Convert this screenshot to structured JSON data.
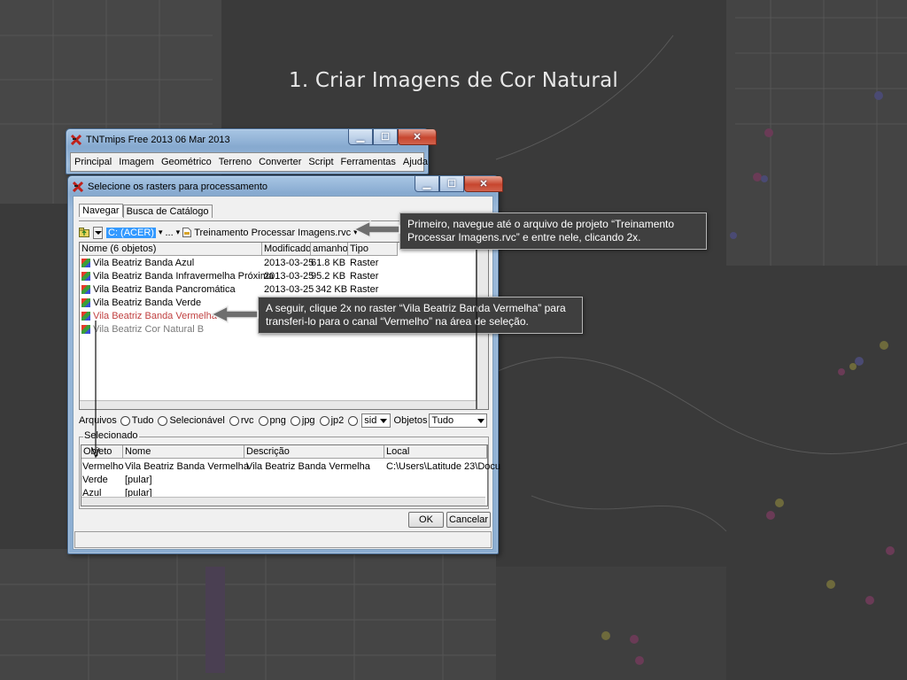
{
  "slide": {
    "title": "1. Criar Imagens de Cor Natural"
  },
  "main_window": {
    "title": "TNTmips Free 2013   06 Mar 2013",
    "menu": [
      "Principal",
      "Imagem",
      "Geométrico",
      "Terreno",
      "Converter",
      "Script",
      "Ferramentas",
      "Ajuda"
    ]
  },
  "dialog": {
    "title": "Selecione os rasters para processamento",
    "tabs": [
      "Navegar",
      "Busca de Catálogo"
    ],
    "path": {
      "drive": "C: (ACER)",
      "ellipsis": "...",
      "project": "Treinamento Processar Imagens.rvc"
    },
    "list_headers": [
      "Nome  (6 objetos)",
      "Modificado",
      "amanho",
      "Tipo"
    ],
    "list_rows": [
      {
        "name": "Vila Beatriz Banda Azul",
        "modified": "2013-03-25",
        "size": "61.8 KB",
        "type": "Raster"
      },
      {
        "name": "Vila Beatriz Banda Infravermelha Próxima",
        "modified": "2013-03-25",
        "size": "95.2 KB",
        "type": "Raster"
      },
      {
        "name": "Vila Beatriz Banda Pancromática",
        "modified": "2013-03-25",
        "size": "342 KB",
        "type": "Raster"
      },
      {
        "name": "Vila Beatriz Banda Verde",
        "modified": "",
        "size": "",
        "type": ""
      },
      {
        "name": "Vila Beatriz Banda Vermelha",
        "modified": "",
        "size": "",
        "type": ""
      },
      {
        "name": "Vila Beatriz Cor Natural B",
        "modified": "",
        "size": "",
        "type": ""
      }
    ],
    "filter": {
      "label": "Arquivos",
      "options": [
        "Tudo",
        "Selecionável",
        "rvc",
        "png",
        "jpg",
        "jp2"
      ],
      "ext_value": "sid",
      "objects_label": "Objetos",
      "objects_value": "Tudo"
    },
    "selected_group": {
      "title": "Selecionado",
      "headers": [
        "Objeto",
        "Nome",
        "Descrição",
        "Local"
      ],
      "rows": [
        {
          "object": "Vermelho",
          "name": "Vila Beatriz Banda Vermelha",
          "description": "Vila Beatriz Banda Vermelha",
          "location": "C:\\Users\\Latitude 23\\Docu"
        },
        {
          "object": "Verde",
          "name": "[pular]",
          "description": "",
          "location": ""
        },
        {
          "object": "Azul",
          "name": "[pular]",
          "description": "",
          "location": ""
        }
      ]
    },
    "buttons": {
      "ok": "OK",
      "cancel": "Cancelar"
    }
  },
  "callouts": [
    {
      "text": "Primeiro, navegue até o arquivo de projeto “Treinamento Processar Imagens.rvc” e entre nele, clicando 2x."
    },
    {
      "text": "A seguir, clique 2x no raster “Vila Beatriz Banda Vermelha” para transferi-lo para o canal “Vermelho” na área de seleção."
    }
  ]
}
